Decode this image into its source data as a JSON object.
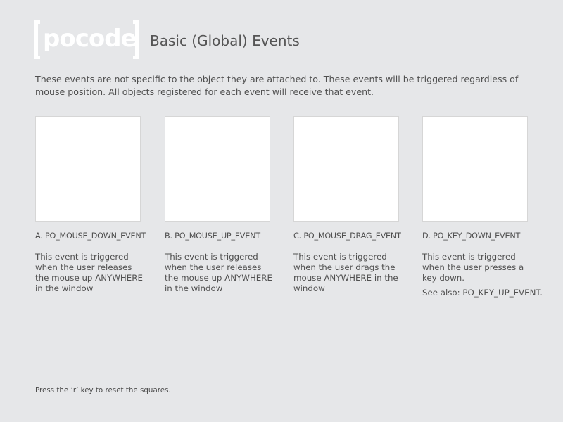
{
  "logo": {
    "text": "pocode"
  },
  "header": {
    "title": "Basic (Global) Events"
  },
  "intro": {
    "text": "These events are not specific to the object they are attached to. These events will be triggered regardless of mouse position. All objects registered for each event will receive that event."
  },
  "events": [
    {
      "label": "A. PO_MOUSE_DOWN_EVENT",
      "description": "This event is triggered when the user releases the mouse up ANYWHERE in the window"
    },
    {
      "label": "B. PO_MOUSE_UP_EVENT",
      "description": "This event is triggered when the user releases the mouse up ANYWHERE in the window"
    },
    {
      "label": "C. PO_MOUSE_DRAG_EVENT",
      "description": "This event is triggered when the user drags the mouse ANYWHERE in the window"
    },
    {
      "label": "D. PO_KEY_DOWN_EVENT",
      "description": "This event is triggered when the user presses a key down.",
      "see_also": "See also: PO_KEY_UP_EVENT."
    }
  ],
  "footer": {
    "hint": "Press the ‘r’ key to reset the squares."
  },
  "colors": {
    "background": "#e6e7e9",
    "square": "#ffffff",
    "logo": "#ffffff"
  }
}
